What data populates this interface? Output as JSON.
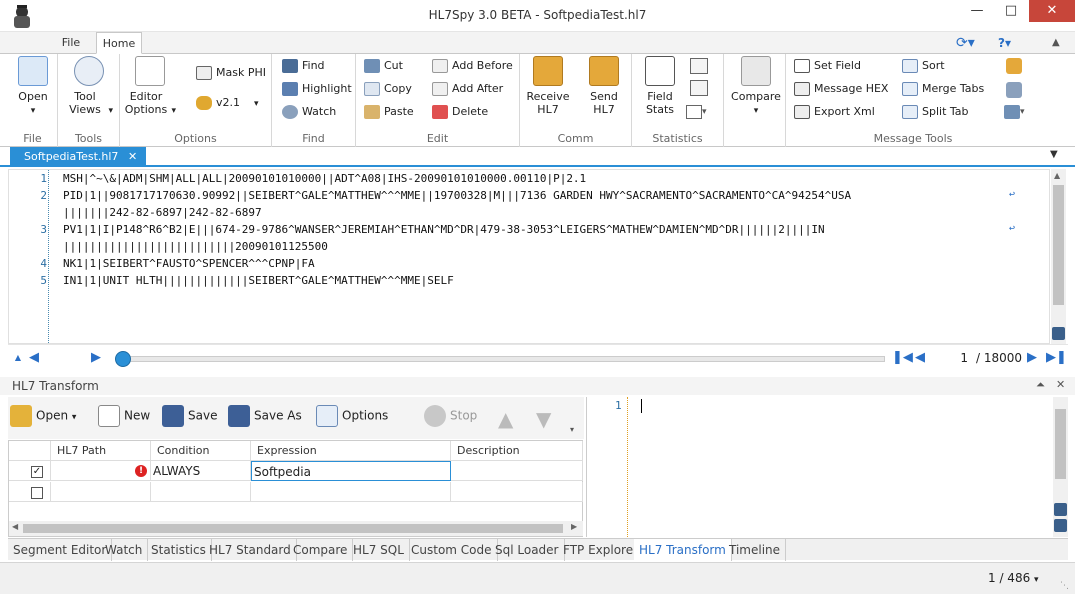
{
  "window": {
    "title": "HL7Spy 3.0 BETA - SoftpediaTest.hl7"
  },
  "ribbon_tabs": [
    {
      "label": "File"
    },
    {
      "label": "Home"
    }
  ],
  "groups": {
    "file": {
      "label": "File",
      "open": "Open"
    },
    "tools": {
      "label": "Tools",
      "tool_views": "Tool Views"
    },
    "options": {
      "label": "Options",
      "editor_options": "Editor Options",
      "mask_phi": "Mask PHI",
      "version": "v2.1"
    },
    "find": {
      "label": "Find",
      "find": "Find",
      "highlight": "Highlight",
      "watch": "Watch"
    },
    "edit": {
      "label": "Edit",
      "cut": "Cut",
      "copy": "Copy",
      "paste": "Paste",
      "add_before": "Add Before",
      "add_after": "Add After",
      "delete": "Delete"
    },
    "comm": {
      "label": "Comm",
      "receive": "Receive HL7",
      "send": "Send HL7"
    },
    "statistics": {
      "label": "Statistics",
      "field_stats": "Field Stats"
    },
    "compare": {
      "label": "Compare"
    },
    "message_tools": {
      "label": "Message Tools",
      "set_field": "Set Field",
      "message_hex": "Message HEX",
      "export_xml": "Export Xml",
      "sort": "Sort",
      "merge_tabs": "Merge Tabs",
      "split_tab": "Split Tab"
    }
  },
  "document_tab": {
    "label": "SoftpediaTest.hl7"
  },
  "editor": {
    "lines": [
      {
        "n": "1",
        "text": "MSH|^~\\&|ADM|SHM|ALL|ALL|20090101010000||ADT^A08|IHS-20090101010000.00110|P|2.1"
      },
      {
        "n": "2",
        "text": "PID|1||9081717170630.90992||SEIBERT^GALE^MATTHEW^^^MME||19700328|M|||7136 GARDEN HWY^SACRAMENTO^SACRAMENTO^CA^94254^USA"
      },
      {
        "n": "",
        "text": "|||||||242-82-6897|242-82-6897"
      },
      {
        "n": "3",
        "text": "PV1|1|I|P148^R6^B2|E|||674-29-9786^WANSER^JEREMIAH^ETHAN^MD^DR|479-38-3053^LEIGERS^MATHEW^DAMIEN^MD^DR||||||2||||IN"
      },
      {
        "n": "",
        "text": "||||||||||||||||||||||||||20090101125500"
      },
      {
        "n": "4",
        "text": "NK1|1|SEIBERT^FAUSTO^SPENCER^^^CPNP|FA"
      },
      {
        "n": "5",
        "text": "IN1|1|UNIT HLTH|||||||||||||SEIBERT^GALE^MATTHEW^^^MME|SELF"
      }
    ]
  },
  "navigation": {
    "current": "1",
    "total": "/ 18000"
  },
  "transform": {
    "title": "HL7 Transform",
    "toolbar": {
      "open": "Open",
      "new": "New",
      "save": "Save",
      "save_as": "Save As",
      "options": "Options",
      "stop": "Stop"
    },
    "columns": [
      "HL7 Path",
      "Condition",
      "Expression",
      "Description"
    ],
    "rows": [
      {
        "checked": true,
        "path": "",
        "condition": "ALWAYS",
        "expression": "Softpedia",
        "description": ""
      },
      {
        "checked": false,
        "path": "",
        "condition": "",
        "expression": "",
        "description": ""
      }
    ],
    "script_line": "1"
  },
  "bottom_tabs": [
    {
      "label": "Segment Editor"
    },
    {
      "label": "Watch"
    },
    {
      "label": "Statistics"
    },
    {
      "label": "HL7 Standard"
    },
    {
      "label": "Compare"
    },
    {
      "label": "HL7 SQL"
    },
    {
      "label": "Custom Code"
    },
    {
      "label": "Sql Loader"
    },
    {
      "label": "FTP Explorer"
    },
    {
      "label": "HL7 Transform"
    },
    {
      "label": "Timeline"
    }
  ],
  "status": {
    "page": "1 / 486"
  },
  "colors": {
    "accent": "#2a8fd6",
    "close": "#c7463a"
  }
}
